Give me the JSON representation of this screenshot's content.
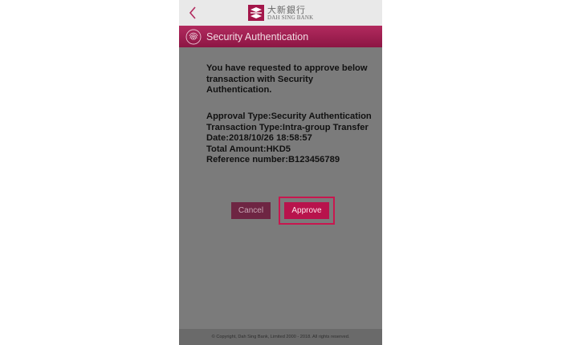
{
  "header": {
    "logo_cn": "大新銀行",
    "logo_en": "DAH SING BANK",
    "back_icon": "chevron-left-icon"
  },
  "titlebar": {
    "title": "Security Authentication",
    "icon": "fingerprint-icon"
  },
  "dialog": {
    "message": "You have requested to approve below transaction with Security Authentication.",
    "details": [
      "Approval Type:Security Authentication",
      "Transaction Type:Intra-group Transfer",
      "Date:2018/10/26 18:58:57",
      "Total Amount:HKD5",
      "Reference number:B123456789"
    ],
    "cancel_label": "Cancel",
    "approve_label": "Approve"
  },
  "footer": {
    "copyright": "© Copyright, Dah Sing Bank, Limited 2000 - 2018. All rights reserved."
  },
  "colors": {
    "brand": "#9a1c4f",
    "overlay": "#7b7b7b",
    "highlight": "#c8174f"
  }
}
